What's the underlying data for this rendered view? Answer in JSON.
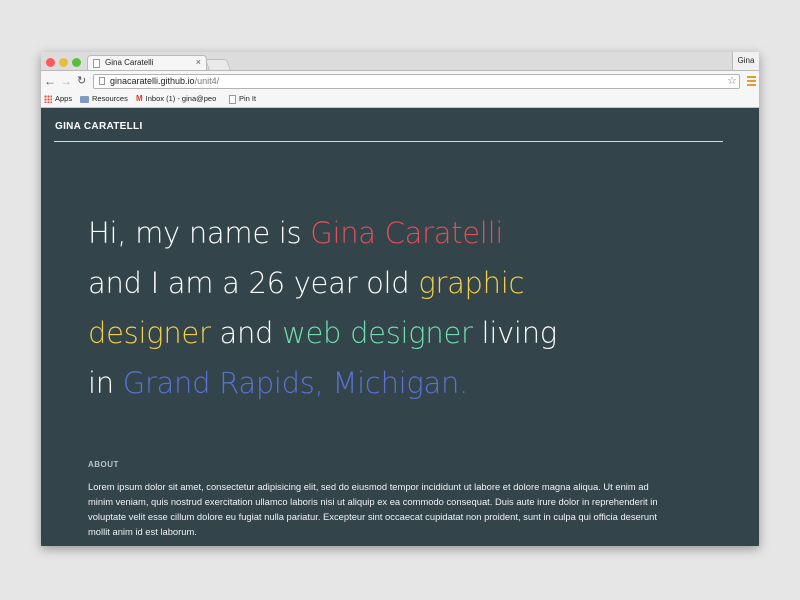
{
  "browser": {
    "tab_title": "Gina Caratelli",
    "tab_close": "×",
    "profile_name": "Gina",
    "url_host": "ginacaratelli.github.io",
    "url_path": "/unit4/",
    "bookmarks": [
      {
        "label": "Apps",
        "icon": "apps-icon"
      },
      {
        "label": "Resources",
        "icon": "folder-icon"
      },
      {
        "label": "Inbox (1) - gina@peo",
        "icon": "gmail-icon"
      },
      {
        "label": "Pin It",
        "icon": "page-icon"
      }
    ],
    "traffic_colors": [
      "#fc5b57",
      "#e5bf3c",
      "#57c038"
    ],
    "menu_color": "#e89a2c"
  },
  "site": {
    "title": "GINA CARATELLI",
    "background": "#33444b",
    "hero": {
      "t1": "Hi, my name is ",
      "name": "Gina Caratelli",
      "t2": "and I am a 26 year old ",
      "graphic": "graphic",
      "designer": "designer",
      "t3": " and ",
      "web_designer": "web designer",
      "t4": " living",
      "t5": "in ",
      "location": "Grand Rapids, Michigan."
    },
    "accent_colors": {
      "name": "#e0505a",
      "graphic_designer": "#f2cf4a",
      "web_designer": "#6fdcae",
      "location": "#5a72d4"
    },
    "about": {
      "heading": "ABOUT",
      "text": "Lorem ipsum dolor sit amet, consectetur adipisicing elit, sed do eiusmod tempor incididunt ut labore et dolore magna aliqua. Ut enim ad minim veniam, quis nostrud exercitation ullamco laboris nisi ut aliquip ex ea commodo consequat. Duis aute irure dolor in reprehenderit in voluptate velit esse cillum dolore eu fugiat nulla pariatur. Excepteur sint occaecat cupidatat non proident, sunt in culpa qui officia deserunt mollit anim id est laborum."
    }
  }
}
